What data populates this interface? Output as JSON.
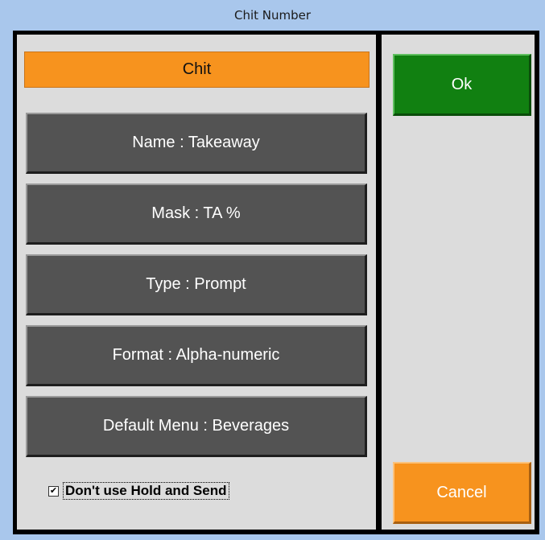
{
  "window": {
    "title": "Chit Number"
  },
  "header": {
    "label": "Chit"
  },
  "options": [
    {
      "label": "Name : Takeaway"
    },
    {
      "label": "Mask : TA %"
    },
    {
      "label": "Type : Prompt"
    },
    {
      "label": "Format : Alpha-numeric"
    },
    {
      "label": "Default Menu : Beverages"
    }
  ],
  "checkbox": {
    "checked": true,
    "mark": "✔",
    "label": "Don't use Hold and Send"
  },
  "actions": {
    "ok_label": "Ok",
    "cancel_label": "Cancel"
  },
  "colors": {
    "accent_orange": "#f7931e",
    "ok_green": "#118011",
    "option_gray": "#535353",
    "panel_gray": "#dcdcdc",
    "frame": "#a9c7ec"
  }
}
